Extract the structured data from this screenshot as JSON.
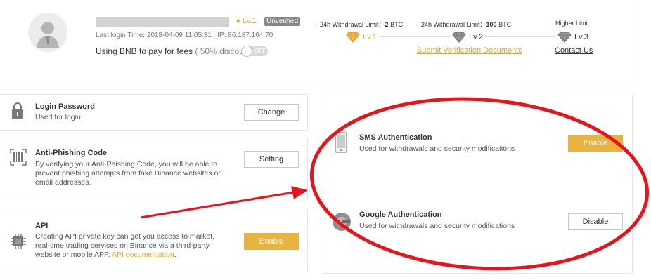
{
  "profile": {
    "level_badge": "Lv.1",
    "unverified_label": "Unverified",
    "last_login": "Last login Time: 2018-04-09 11:05:31",
    "ip": "IP: 86.187.164.70",
    "bnb_text": "Using BNB to pay for fees",
    "bnb_discount": "( 50% discount )",
    "toggle_label": "OFF"
  },
  "limits": {
    "lv1_label": "24h Withdrawal Limit：",
    "lv1_value": "2",
    "lv1_unit": "BTC",
    "lv2_label": "24h Withdrawal Limit：",
    "lv2_value": "100",
    "lv2_unit": "BTC",
    "lv3_label": "Higher Limit",
    "levels": [
      "Lv.1",
      "Lv.2",
      "Lv.3"
    ],
    "submit_link": "Submit Verification Documents",
    "contact_link": "Contact Us"
  },
  "cards": {
    "login": {
      "title": "Login Password",
      "desc": "Used for login",
      "button": "Change"
    },
    "phishing": {
      "title": "Anti-Phishing Code",
      "desc_lines": [
        "By verifying your Anti-Phishing Code, you will be able to",
        "prevent phishing attempts from fake Binance websites or",
        "email addresses."
      ],
      "button": "Setting"
    },
    "api": {
      "title": "API",
      "desc_lines": [
        "Creating API private key can get you access to market,",
        "real-time trading services on Binance via a third-party",
        "website or mobile APP. "
      ],
      "link": "API documentation",
      "suffix": ".",
      "button": "Enable"
    }
  },
  "auth": {
    "sms": {
      "title": "SMS Authentication",
      "desc": "Used for withdrawals and security modifications",
      "button": "Enable"
    },
    "google": {
      "title": "Google Authentication",
      "desc": "Used for withdrawals and security modifications",
      "button": "Disable"
    }
  },
  "colors": {
    "gold": "#e8b33f",
    "annotation": "#e8141b"
  },
  "icons": [
    "user-avatar-icon",
    "diamond-icon",
    "lock-icon",
    "barcode-icon",
    "chip-icon",
    "phone-icon",
    "google-auth-icon"
  ]
}
